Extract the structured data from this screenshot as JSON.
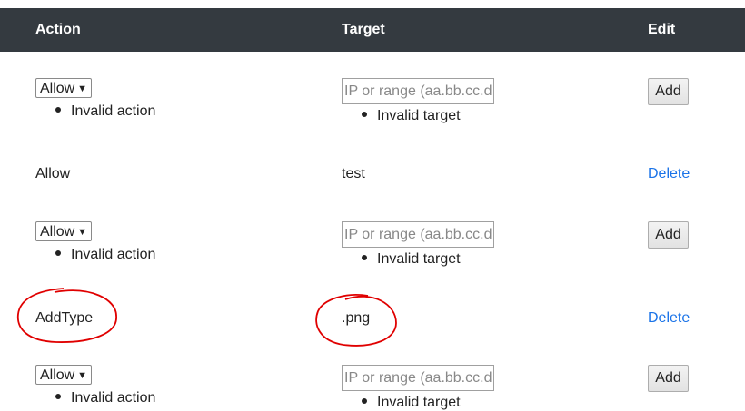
{
  "header": {
    "action": "Action",
    "target": "Target",
    "edit": "Edit"
  },
  "form_rows": [
    {
      "action_value": "Allow",
      "action_error": "Invalid action",
      "target_placeholder": "IP or range (aa.bb.cc.dd",
      "target_error": "Invalid target",
      "add_label": "Add"
    },
    {
      "action_value": "Allow",
      "action_error": "Invalid action",
      "target_placeholder": "IP or range (aa.bb.cc.dd",
      "target_error": "Invalid target",
      "add_label": "Add"
    },
    {
      "action_value": "Allow",
      "action_error": "Invalid action",
      "target_placeholder": "IP or range (aa.bb.cc.dd",
      "target_error": "Invalid target",
      "add_label": "Add"
    }
  ],
  "rules": [
    {
      "action": "Allow",
      "target": "test",
      "delete_label": "Delete"
    },
    {
      "action": "AddType",
      "target": ".png",
      "delete_label": "Delete"
    }
  ],
  "colors": {
    "header_bg": "#343a40",
    "link": "#1a73e8",
    "annotation": "#e00000"
  },
  "icons": {
    "select_caret": "dropdown-caret-icon"
  }
}
